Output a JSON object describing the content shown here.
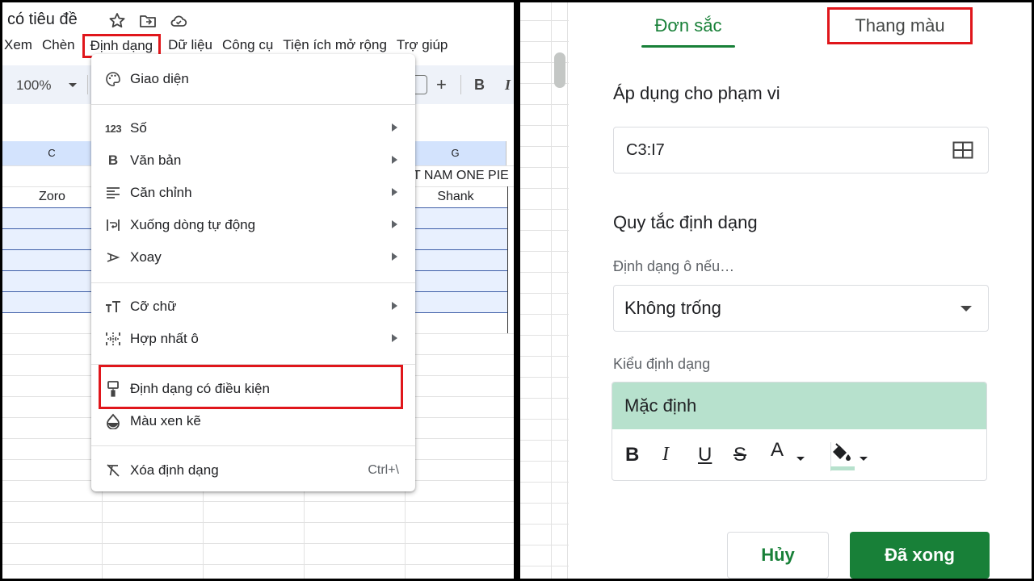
{
  "left": {
    "doc_title": "có tiêu đề",
    "menubar": [
      "Xem",
      "Chèn",
      "Định dạng",
      "Dữ liệu",
      "Công cụ",
      "Tiện ích mở rộng",
      "Trợ giúp"
    ],
    "zoom": "100%",
    "columns": {
      "c": "C",
      "g": "G"
    },
    "cells": {
      "title_fragment": "T NAM ONE PIE",
      "c_header": "Zoro",
      "g_header": "Shank"
    },
    "format_menu": {
      "theme": "Giao diện",
      "number": "Số",
      "text": "Văn bản",
      "align": "Căn chỉnh",
      "wrap": "Xuống dòng tự động",
      "rotate": "Xoay",
      "font_size": "Cỡ chữ",
      "merge": "Hợp nhất ô",
      "conditional": "Định dạng có điều kiện",
      "alternating": "Màu xen kẽ",
      "clear": "Xóa định dạng",
      "clear_shortcut": "Ctrl+\\",
      "number_icon": "123",
      "text_icon": "B"
    }
  },
  "right": {
    "tab_single": "Đơn sắc",
    "tab_scale": "Thang màu",
    "apply_heading": "Áp dụng cho phạm vi",
    "range": "C3:I7",
    "rules_heading": "Quy tắc định dạng",
    "condition_label": "Định dạng ô nếu…",
    "condition_value": "Không trống",
    "style_label": "Kiểu định dạng",
    "style_preview": "Mặc định",
    "fmt": {
      "bold": "B",
      "italic": "I",
      "underline": "U",
      "strike": "S",
      "text_color": "A"
    },
    "cancel": "Hủy",
    "done": "Đã xong"
  },
  "colors": {
    "accent_green": "#188038",
    "highlight_red": "#e0161b",
    "preview_bg": "#b7e1cd",
    "selection": "#e8f0fe"
  }
}
